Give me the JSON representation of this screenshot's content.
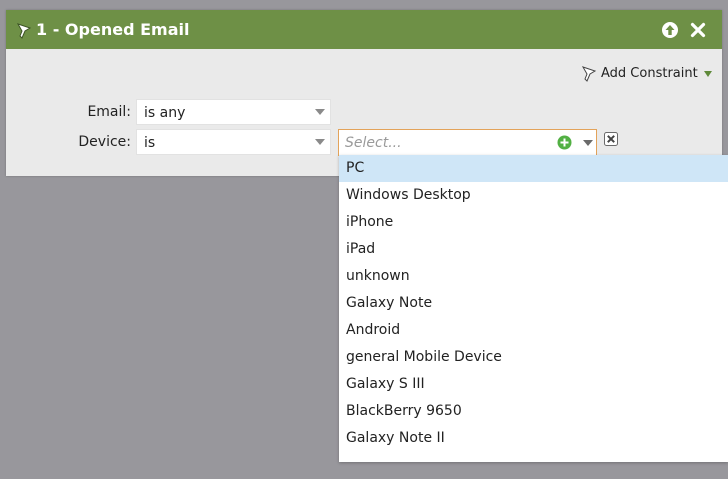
{
  "colors": {
    "background": "#98979c",
    "header_green": "#6e9046",
    "panel_bg": "#eaeaea",
    "highlight": "#cfe6f7",
    "focus_border": "#e3a35a",
    "add_green": "#52b043"
  },
  "panel": {
    "title": "1 - Opened Email",
    "header_icon": "filter-funnel-icon",
    "collapse_icon": "arrow-up-circle-icon",
    "close_icon": "close-x-icon"
  },
  "toolbar": {
    "add_constraint_label": "Add Constraint",
    "add_constraint_icon": "filter-funnel-icon"
  },
  "filters": {
    "email": {
      "label": "Email:",
      "operator": "is any"
    },
    "device": {
      "label": "Device:",
      "operator": "is",
      "value_placeholder": "Select...",
      "add_icon": "plus-circle-icon",
      "remove_icon": "remove-box-icon"
    }
  },
  "device_options": [
    {
      "label": "PC",
      "selected": true
    },
    {
      "label": "Windows Desktop",
      "selected": false
    },
    {
      "label": "iPhone",
      "selected": false
    },
    {
      "label": "iPad",
      "selected": false
    },
    {
      "label": "unknown",
      "selected": false
    },
    {
      "label": "Galaxy Note",
      "selected": false
    },
    {
      "label": "Android",
      "selected": false
    },
    {
      "label": "general Mobile Device",
      "selected": false
    },
    {
      "label": "Galaxy S III",
      "selected": false
    },
    {
      "label": "BlackBerry 9650",
      "selected": false
    },
    {
      "label": "Galaxy Note II",
      "selected": false
    }
  ]
}
